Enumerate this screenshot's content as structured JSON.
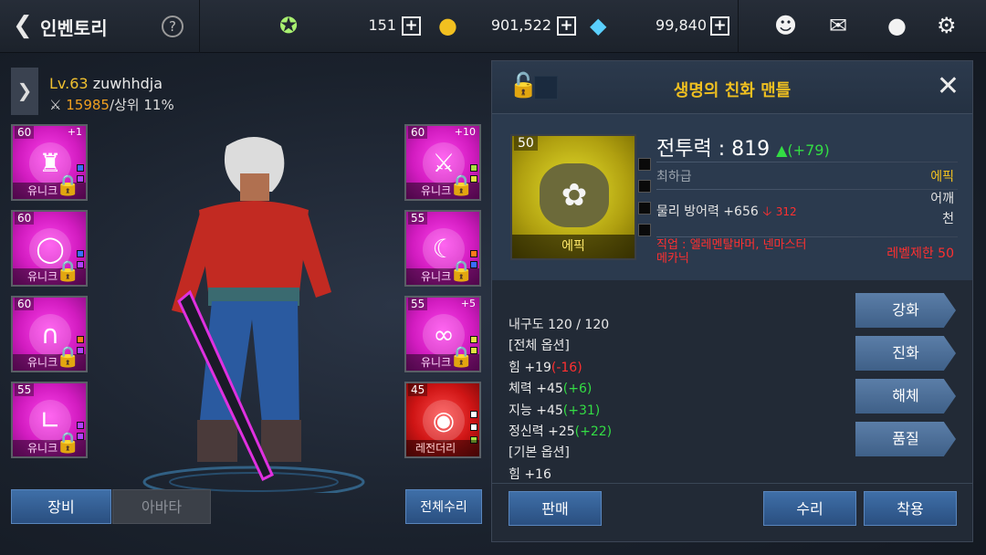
{
  "header": {
    "back_icon": "chevron-left-icon",
    "title": "인벤토리",
    "help_label": "?",
    "resources": [
      {
        "icon": "energy-capsule-icon",
        "value": "151"
      },
      {
        "icon": "gold-coin-icon",
        "value": "901,522"
      },
      {
        "icon": "diamond-icon",
        "value": "99,840"
      }
    ],
    "plus_label": "+",
    "icons": [
      "friends-icon",
      "mail-icon",
      "chat-icon",
      "gear-icon"
    ]
  },
  "character": {
    "expand_icon": "chevron-right-icon",
    "level_prefix": "Lv.63",
    "name": "zuwhhdja",
    "power": "15985",
    "rank": "/상위 11%",
    "left_slots": [
      {
        "level": "60",
        "enhance": "+1",
        "grade": "유니크",
        "item": "chest-armor"
      },
      {
        "level": "60",
        "enhance": "",
        "grade": "유니크",
        "item": "belt"
      },
      {
        "level": "60",
        "enhance": "",
        "grade": "유니크",
        "item": "pants"
      },
      {
        "level": "55",
        "enhance": "",
        "grade": "유니크",
        "item": "boots"
      }
    ],
    "right_slots": [
      {
        "level": "60",
        "enhance": "+10",
        "grade": "유니크",
        "item": "greatsword",
        "color": "magenta"
      },
      {
        "level": "55",
        "enhance": "",
        "grade": "유니크",
        "item": "shoulder",
        "color": "magenta"
      },
      {
        "level": "55",
        "enhance": "+5",
        "grade": "유니크",
        "item": "necklace",
        "color": "magenta"
      },
      {
        "level": "45",
        "enhance": "",
        "grade": "레전더리",
        "item": "ring",
        "color": "red"
      }
    ],
    "tabs": {
      "equip": "장비",
      "avatar": "아바타"
    },
    "repair_all": "전체수리"
  },
  "item_detail": {
    "title": "생명의 친화 맨틀",
    "close_icon": "close-icon",
    "lock_icon": "unlock-icon",
    "level": "50",
    "grade_label": "에픽",
    "combat_power": "전투력 : 819",
    "combat_delta": "▲(+79)",
    "quality": "최하급",
    "rarity": "에픽",
    "defense": "물리 방어력 +656",
    "defense_delta": "312",
    "slot_type": "어깨\n천",
    "job_req": "직업 : 엘레멘탈바머, 넨마스터\n메카닉",
    "level_req": "레벨제한 50",
    "durability": "내구도 120 / 120",
    "options": [
      {
        "text": "[전체 옵션]",
        "delta": "",
        "kind": "header"
      },
      {
        "text": "힘 +19",
        "delta": "(-16)",
        "kind": "neg"
      },
      {
        "text": "체력 +45",
        "delta": "(+6)",
        "kind": "pos"
      },
      {
        "text": "지능 +45",
        "delta": "(+31)",
        "kind": "pos"
      },
      {
        "text": "정신력 +25",
        "delta": "(+22)",
        "kind": "pos"
      },
      {
        "text": "[기본 옵션]",
        "delta": "",
        "kind": "header"
      },
      {
        "text": "힘 +16",
        "delta": "",
        "kind": "blue"
      }
    ],
    "side_buttons": [
      "강화",
      "진화",
      "해체",
      "품질"
    ],
    "sell": "판매",
    "repair": "수리",
    "equip": "착용"
  },
  "colors": {
    "gold": "#f0c020",
    "positive": "#33dd44",
    "negative": "#ff3030",
    "unique": "#d21cc0",
    "legendary": "#cf1515",
    "epic": "#b0a010"
  }
}
